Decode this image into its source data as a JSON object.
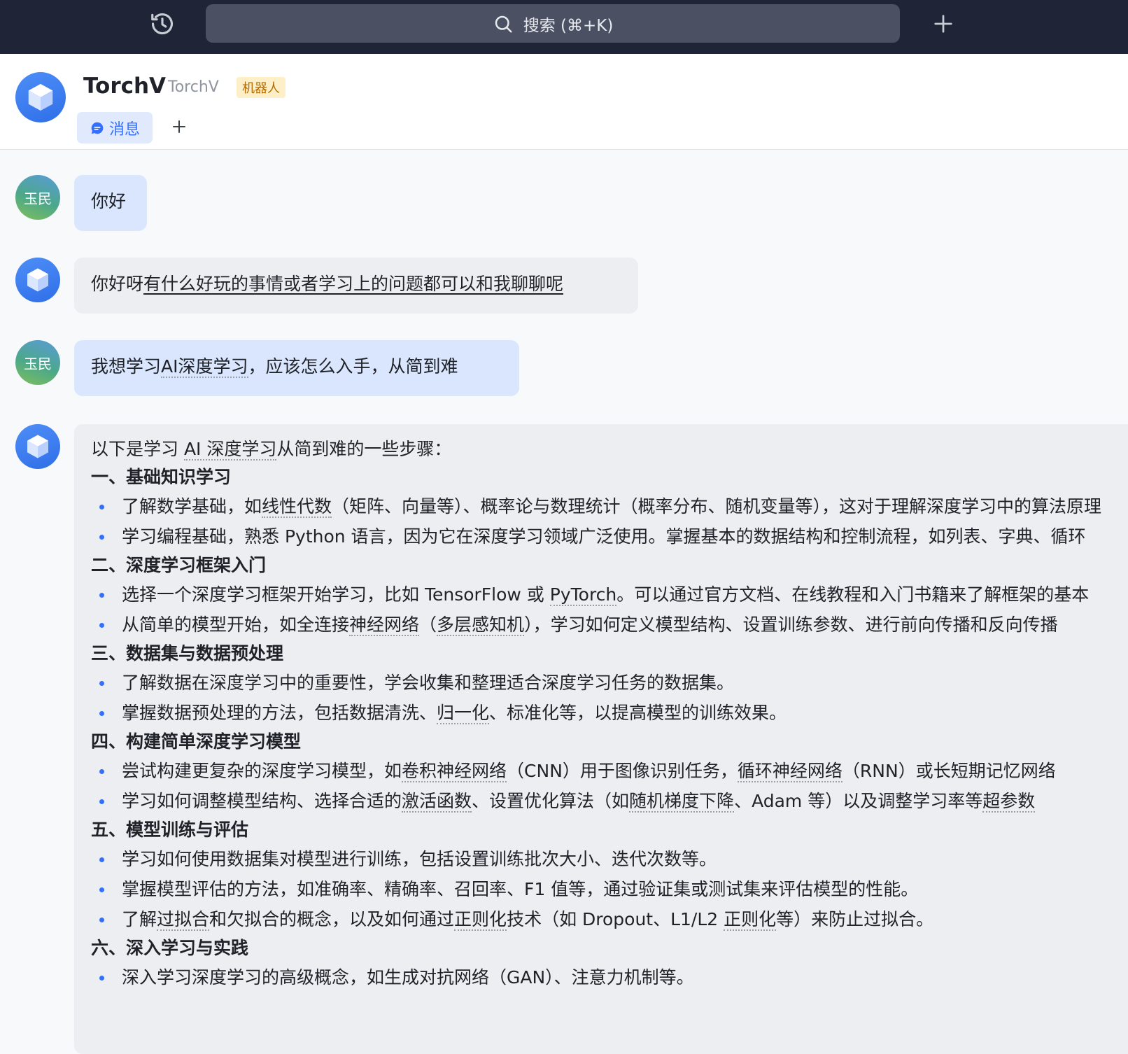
{
  "topbar": {
    "search_placeholder": "搜索 (⌘+K)"
  },
  "header": {
    "title": "TorchV",
    "subtitle": "TorchV",
    "badge": "机器人",
    "tab_message": "消息"
  },
  "user": {
    "avatar_text": "玉民"
  },
  "colors": {
    "accent": "#3370ff",
    "topbar": "#1f2437",
    "user_bubble": "#d9e6fd",
    "bot_bubble": "#eceef1"
  },
  "messages": {
    "m1": "你好",
    "m2_prefix": "你好呀",
    "m2_link": "有什么好玩的事情或者学习上的问题都可以和我聊聊呢",
    "m3_a": "我想学习",
    "m3_b": "AI深度学习",
    "m3_c": "，应该怎么入手，从简到难"
  },
  "answer": {
    "intro_a": "以下是学习 ",
    "intro_b": "AI 深度学习",
    "intro_c": "从简到难的一些步骤：",
    "s1": "一、基础知识学习",
    "s1_b1a": "了解数学基础，如",
    "s1_b1b": "线性代数",
    "s1_b1c": "（矩阵、向量等）、概率论与数理统计（概率分布、随机变量等），这对于理解深度学习中的算法原理",
    "s1_b2": "学习编程基础，熟悉 Python 语言，因为它在深度学习领域广泛使用。掌握基本的数据结构和控制流程，如列表、字典、循环",
    "s2": "二、深度学习框架入门",
    "s2_b1a": "选择一个深度学习框架开始学习，比如 TensorFlow 或 ",
    "s2_b1b": "PyTorch",
    "s2_b1c": "。可以通过官方文档、在线教程和入门书籍来了解框架的基本",
    "s2_b2a": "从简单的模型开始，如全连接",
    "s2_b2b": "神经网络",
    "s2_b2c": "（",
    "s2_b2d": "多层感知机",
    "s2_b2e": "），学习如何定义模型结构、设置训练参数、进行前向传播和反向传播",
    "s3": "三、数据集与数据预处理",
    "s3_b1": "了解数据在深度学习中的重要性，学会收集和整理适合深度学习任务的数据集。",
    "s3_b2a": "掌握数据预处理的方法，包括数据清洗、",
    "s3_b2b": "归一化",
    "s3_b2c": "、标准化等，以提高模型的训练效果。",
    "s4": "四、构建简单深度学习模型",
    "s4_b1a": "尝试构建更复杂的深度学习模型，如",
    "s4_b1b": "卷积神经网络",
    "s4_b1c": "（CNN）用于图像识别任务，",
    "s4_b1d": "循环神经网络",
    "s4_b1e": "（RNN）或长短期记忆网络",
    "s4_b2a": "学习如何调整模型结构、选择合适的",
    "s4_b2b": "激活函数",
    "s4_b2c": "、设置优化算法（如",
    "s4_b2d": "随机梯度下降",
    "s4_b2e": "、Adam 等）以及调整学习率等",
    "s4_b2f": "超参数",
    "s5": "五、模型训练与评估",
    "s5_b1": "学习如何使用数据集对模型进行训练，包括设置训练批次大小、迭代次数等。",
    "s5_b2": "掌握模型评估的方法，如准确率、精确率、召回率、F1 值等，通过验证集或测试集来评估模型的性能。",
    "s5_b3a": "了解",
    "s5_b3b": "过拟合",
    "s5_b3c": "和欠拟合的概念，以及如何通过",
    "s5_b3d": "正则化",
    "s5_b3e": "技术（如 Dropout、L1/L2 ",
    "s5_b3f": "正则化",
    "s5_b3g": "等）来防止过拟合。",
    "s6": "六、深入学习与实践",
    "s6_b1": "深入学习深度学习的高级概念，如生成对抗网络（GAN）、注意力机制等。"
  }
}
